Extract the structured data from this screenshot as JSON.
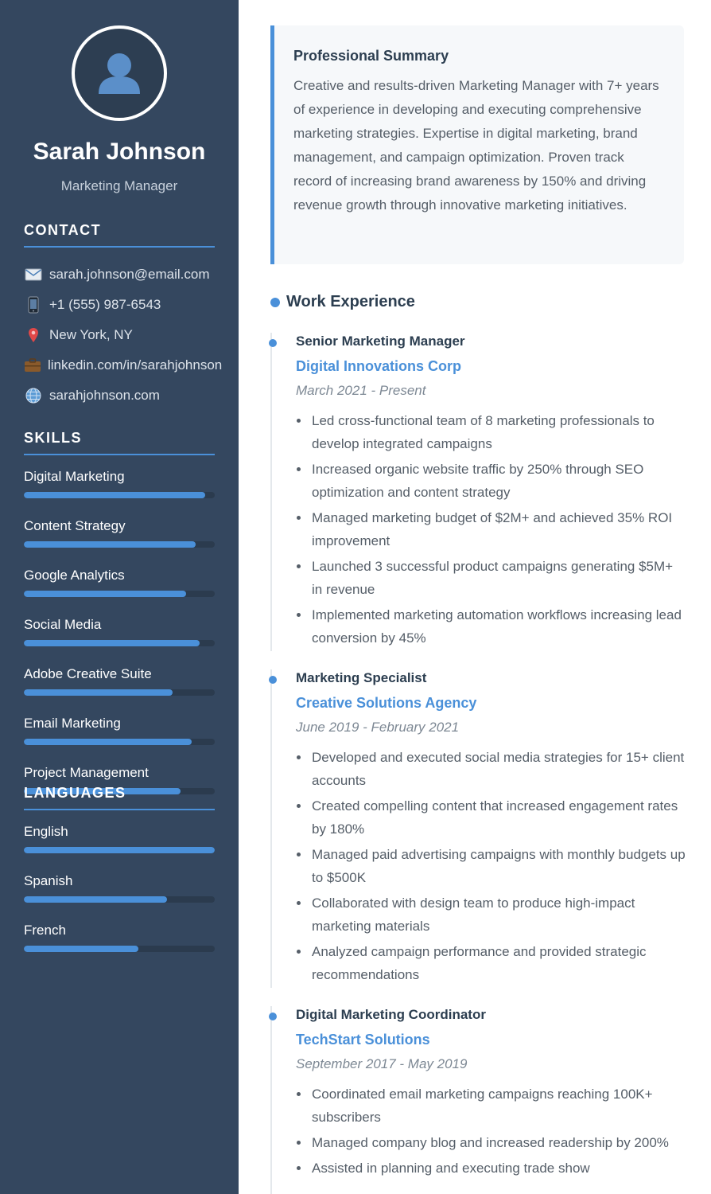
{
  "profile": {
    "name": "Sarah Johnson",
    "role": "Marketing Manager"
  },
  "contact": {
    "heading": "CONTACT",
    "items": [
      {
        "icon": "email-icon",
        "text": "sarah.johnson@email.com"
      },
      {
        "icon": "phone-icon",
        "text": "+1 (555) 987-6543"
      },
      {
        "icon": "location-pin-icon",
        "text": "New York, NY"
      },
      {
        "icon": "briefcase-icon",
        "text": "linkedin.com/in/sarahjohnson"
      },
      {
        "icon": "globe-icon",
        "text": "sarahjohnson.com"
      }
    ]
  },
  "skills": {
    "heading": "SKILLS",
    "items": [
      {
        "name": "Digital Marketing",
        "level": 95
      },
      {
        "name": "Content Strategy",
        "level": 90
      },
      {
        "name": "Google Analytics",
        "level": 85
      },
      {
        "name": "Social Media",
        "level": 92
      },
      {
        "name": "Adobe Creative Suite",
        "level": 78
      },
      {
        "name": "Email Marketing",
        "level": 88
      },
      {
        "name": "Project Management",
        "level": 82
      }
    ]
  },
  "languages": {
    "heading": "LANGUAGES",
    "items": [
      {
        "name": "English",
        "level": 100
      },
      {
        "name": "Spanish",
        "level": 75
      },
      {
        "name": "French",
        "level": 60
      }
    ]
  },
  "summary": {
    "title": "Professional Summary",
    "text": "Creative and results-driven Marketing Manager with 7+ years of experience in developing and executing comprehensive marketing strategies. Expertise in digital marketing, brand management, and campaign optimization. Proven track record of increasing brand awareness by 150% and driving revenue growth through innovative marketing initiatives."
  },
  "experience": {
    "title": "Work Experience",
    "jobs": [
      {
        "title": "Senior Marketing Manager",
        "company": "Digital Innovations Corp",
        "dates": "March 2021 - Present",
        "bullets": [
          "Led cross-functional team of 8 marketing professionals to develop integrated campaigns",
          "Increased organic website traffic by 250% through SEO optimization and content strategy",
          "Managed marketing budget of $2M+ and achieved 35% ROI improvement",
          "Launched 3 successful product campaigns generating $5M+ in revenue",
          "Implemented marketing automation workflows increasing lead conversion by 45%"
        ]
      },
      {
        "title": "Marketing Specialist",
        "company": "Creative Solutions Agency",
        "dates": "June 2019 - February 2021",
        "bullets": [
          "Developed and executed social media strategies for 15+ client accounts",
          "Created compelling content that increased engagement rates by 180%",
          "Managed paid advertising campaigns with monthly budgets up to $500K",
          "Collaborated with design team to produce high-impact marketing materials",
          "Analyzed campaign performance and provided strategic recommendations"
        ]
      },
      {
        "title": "Digital Marketing Coordinator",
        "company": "TechStart Solutions",
        "dates": "September 2017 - May 2019",
        "bullets": [
          "Coordinated email marketing campaigns reaching 100K+ subscribers",
          "Managed company blog and increased readership by 200%",
          "Assisted in planning and executing trade show"
        ]
      }
    ]
  },
  "colors": {
    "sidebar": "#34475f",
    "accent": "#4a90d9",
    "heading": "#2c3e50",
    "body_text": "#555e68"
  }
}
